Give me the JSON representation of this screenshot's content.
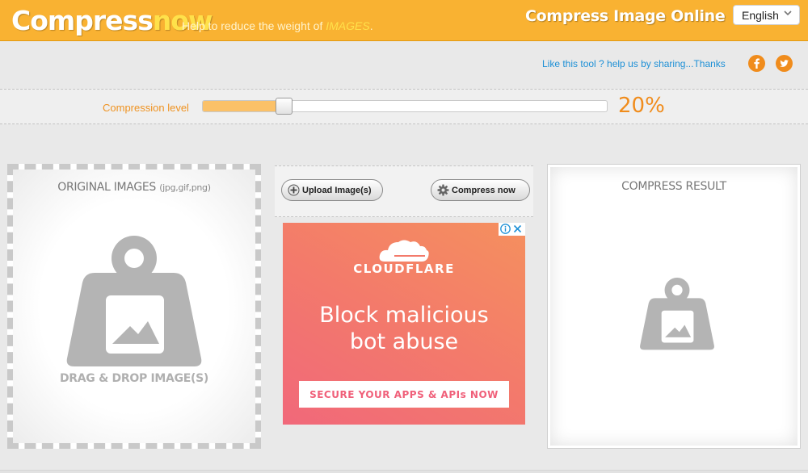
{
  "header": {
    "logo_main": "Compress",
    "logo_accent": "now",
    "tagline_prefix": "Help to reduce the weight of ",
    "tagline_emphasis": "IMAGES",
    "tagline_suffix": ".",
    "site_heading": "Compress Image Online",
    "language": {
      "selected": "English"
    }
  },
  "share": {
    "text": "Like this tool ? help us by sharing...Thanks",
    "icons": [
      "facebook-icon",
      "twitter-icon"
    ]
  },
  "compression": {
    "label": "Compression level",
    "value_text": "20%",
    "value_fraction": 0.2
  },
  "original_panel": {
    "title": "ORIGINAL IMAGES",
    "formats": "(jpg,gif,png)",
    "drop_text": "DRAG & DROP IMAGE(S)"
  },
  "toolbar": {
    "upload_label": "Upload Image(s)",
    "compress_label": "Compress now"
  },
  "ad": {
    "brand": "CLOUDFLARE",
    "headline_line1": "Block malicious",
    "headline_line2": "bot abuse",
    "cta": "SECURE YOUR APPS & APIs NOW"
  },
  "result_panel": {
    "title": "COMPRESS RESULT"
  },
  "colors": {
    "header_bg": "#f9b232",
    "accent_orange": "#f08c1c",
    "link_blue": "#1e90d6",
    "slider_fill": "#fbc168",
    "placeholder_gray": "#b4b4b4",
    "ad_gradient_start": "#f1687a",
    "ad_gradient_end": "#f5905e"
  }
}
